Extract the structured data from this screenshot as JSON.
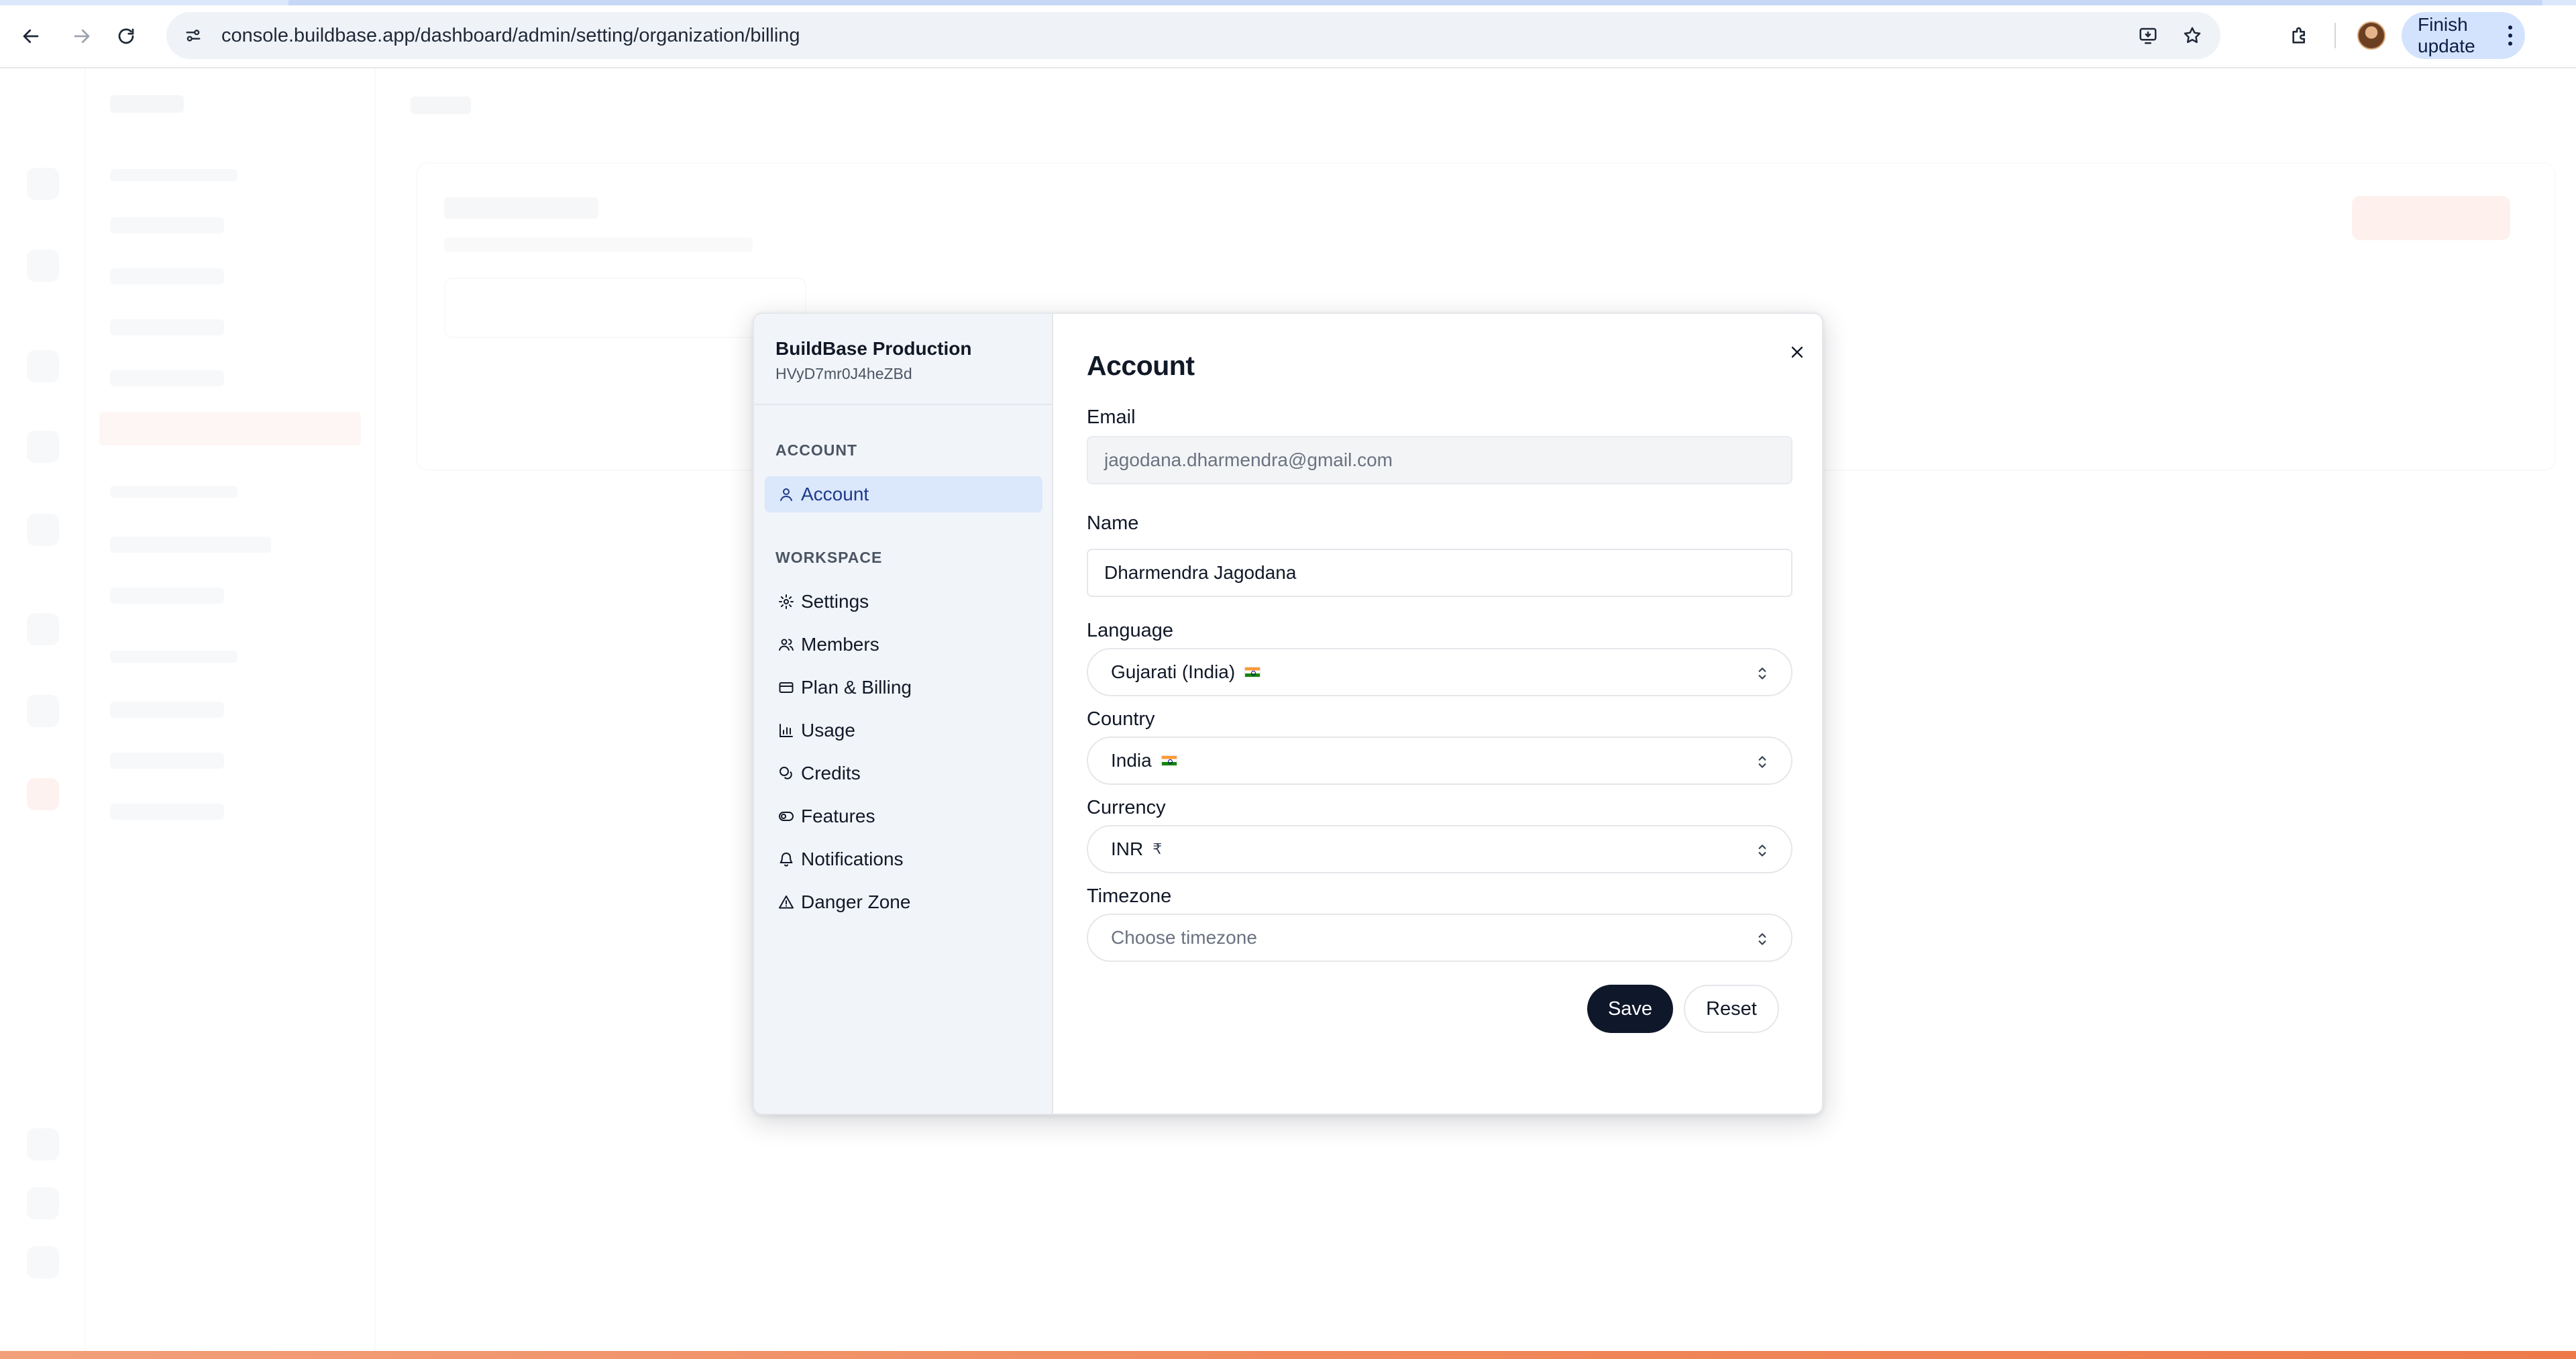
{
  "browser": {
    "url": "console.buildbase.app/dashboard/admin/setting/organization/billing",
    "finish_update_label": "Finish update"
  },
  "modal": {
    "org_name": "BuildBase Production",
    "org_id": "HVyD7mr0J4heZBd",
    "sections": [
      {
        "label": "ACCOUNT",
        "items": [
          {
            "label": "Account",
            "icon": "user-icon",
            "active": true
          }
        ]
      },
      {
        "label": "WORKSPACE",
        "items": [
          {
            "label": "Settings",
            "icon": "gear-icon"
          },
          {
            "label": "Members",
            "icon": "users-icon"
          },
          {
            "label": "Plan & Billing",
            "icon": "credit-card-icon"
          },
          {
            "label": "Usage",
            "icon": "bar-chart-icon"
          },
          {
            "label": "Credits",
            "icon": "coins-icon"
          },
          {
            "label": "Features",
            "icon": "toggle-icon"
          },
          {
            "label": "Notifications",
            "icon": "bell-icon"
          },
          {
            "label": "Danger Zone",
            "icon": "warning-triangle-icon"
          }
        ]
      }
    ],
    "title": "Account",
    "form": {
      "email": {
        "label": "Email",
        "value": "jagodana.dharmendra@gmail.com"
      },
      "name": {
        "label": "Name",
        "value": "Dharmendra Jagodana"
      },
      "language": {
        "label": "Language",
        "value": "Gujarati (India)"
      },
      "country": {
        "label": "Country",
        "value": "India"
      },
      "currency": {
        "label": "Currency",
        "value": "INR",
        "symbol": "₹"
      },
      "timezone": {
        "label": "Timezone",
        "placeholder": "Choose timezone"
      }
    },
    "save_label": "Save",
    "reset_label": "Reset"
  },
  "colors": {
    "primary_button": "#0f172a",
    "active_nav_bg": "#dbe7fb",
    "sidebar_bg": "#f1f4f9",
    "brand_accent": "#ee7a4a"
  }
}
